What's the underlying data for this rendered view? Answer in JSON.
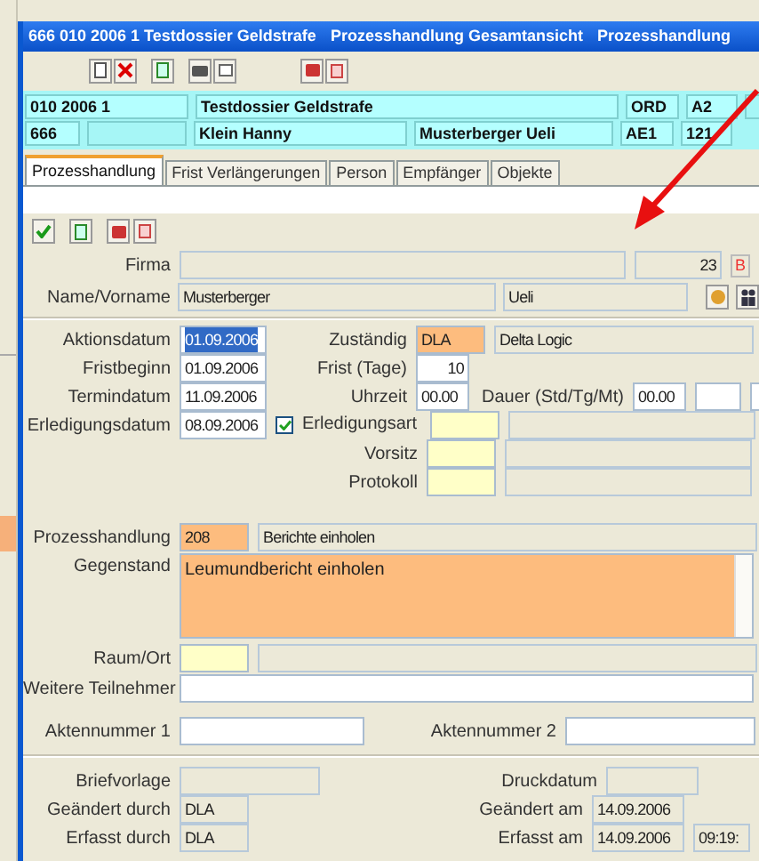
{
  "window": {
    "title_parts": [
      "666 010 2006 1 Testdossier Geldstrafe",
      "Prozesshandlung Gesamtansicht",
      "Prozesshandlung"
    ]
  },
  "header": {
    "dossier": {
      "number": "010 2006 1",
      "title": "Testdossier Geldstrafe",
      "procedure": "ORD",
      "group": "A2"
    },
    "persons": {
      "number": "666",
      "person_1": "Klein Hanny",
      "person_2": "Musterberger Ueli",
      "unit": "AE1",
      "code": "121"
    }
  },
  "tabs": [
    {
      "label": "Prozesshandlung",
      "selected": true
    },
    {
      "label": "Frist Verlängerungen",
      "selected": false
    },
    {
      "label": "Person",
      "selected": false
    },
    {
      "label": "Empfänger",
      "selected": false
    },
    {
      "label": "Objekte",
      "selected": false
    }
  ],
  "firma": {
    "label": "Firma",
    "number": "23",
    "badge": "B"
  },
  "name": {
    "label": "Name/Vorname",
    "last": "Musterberger",
    "first": "Ueli"
  },
  "aktionsdatum": {
    "label": "Aktionsdatum",
    "value": "01.09.2006",
    "selected": true
  },
  "fristbeginn": {
    "label": "Fristbeginn",
    "value": "01.09.2006"
  },
  "termindatum": {
    "label": "Termindatum",
    "value": "11.09.2006"
  },
  "erledigungsdatum": {
    "label": "Erledigungsdatum",
    "value": "08.09.2006"
  },
  "zustaendig": {
    "label": "Zuständig",
    "code": "DLA",
    "name": "Delta Logic"
  },
  "frist": {
    "label": "Frist (Tage)",
    "value": "10"
  },
  "uhrzeit": {
    "label": "Uhrzeit",
    "value": "00.00"
  },
  "dauer": {
    "label": "Dauer (Std/Tg/Mt)",
    "value": "00.00"
  },
  "erledigungsart": {
    "label": "Erledigungsart",
    "checked": true
  },
  "vorsitz": {
    "label": "Vorsitz"
  },
  "protokoll": {
    "label": "Protokoll"
  },
  "prozesshandlung": {
    "label": "Prozesshandlung",
    "code": "208",
    "name": "Berichte einholen"
  },
  "gegenstand": {
    "label": "Gegenstand",
    "value": "Leumundbericht einholen"
  },
  "raum": {
    "label": "Raum/Ort"
  },
  "teilnehmer": {
    "label": "Weitere Teilnehmer"
  },
  "akten": [
    {
      "label": "Aktennummer 1"
    },
    {
      "label": "Aktennummer 2"
    }
  ],
  "audit": {
    "briefvorlage": {
      "label": "Briefvorlage"
    },
    "druckdatum": {
      "label": "Druckdatum"
    },
    "geaendert_durch": {
      "label": "Geändert durch",
      "value": "DLA"
    },
    "geaendert_am": {
      "label": "Geändert am",
      "value": "14.09.2006"
    },
    "erfasst_durch": {
      "label": "Erfasst durch",
      "value": "DLA"
    },
    "erfasst_am": {
      "label": "Erfasst am",
      "value": "14.09.2006",
      "time": "09:19:"
    }
  }
}
